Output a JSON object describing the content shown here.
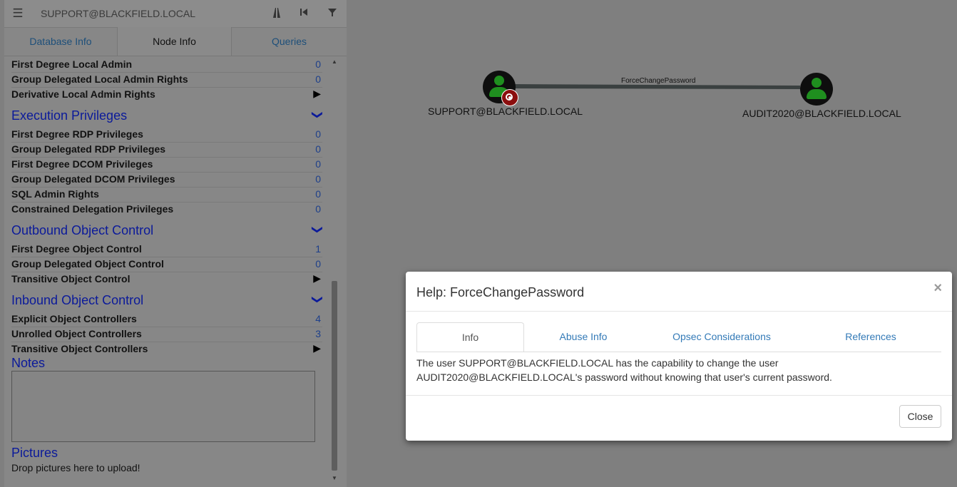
{
  "panel": {
    "search_value": "SUPPORT@BLACKFIELD.LOCAL",
    "icons": [
      "menu-icon",
      "pathfinding-icon",
      "back-icon",
      "filter-icon"
    ],
    "tabs": [
      {
        "label": "Database Info",
        "active": false
      },
      {
        "label": "Node Info",
        "active": true
      },
      {
        "label": "Queries",
        "active": false
      }
    ],
    "local_admin_rows": [
      {
        "label": "First Degree Local Admin",
        "value": "0"
      },
      {
        "label": "Group Delegated Local Admin Rights",
        "value": "0"
      },
      {
        "label": "Derivative Local Admin Rights",
        "value": "▶"
      }
    ],
    "execution": {
      "title": "Execution Privileges",
      "rows": [
        {
          "label": "First Degree RDP Privileges",
          "value": "0"
        },
        {
          "label": "Group Delegated RDP Privileges",
          "value": "0"
        },
        {
          "label": "First Degree DCOM Privileges",
          "value": "0"
        },
        {
          "label": "Group Delegated DCOM Privileges",
          "value": "0"
        },
        {
          "label": "SQL Admin Rights",
          "value": "0"
        },
        {
          "label": "Constrained Delegation Privileges",
          "value": "0"
        }
      ]
    },
    "outbound": {
      "title": "Outbound Object Control",
      "rows": [
        {
          "label": "First Degree Object Control",
          "value": "1"
        },
        {
          "label": "Group Delegated Object Control",
          "value": "0"
        },
        {
          "label": "Transitive Object Control",
          "value": "▶"
        }
      ]
    },
    "inbound": {
      "title": "Inbound Object Control",
      "rows": [
        {
          "label": "Explicit Object Controllers",
          "value": "4"
        },
        {
          "label": "Unrolled Object Controllers",
          "value": "3"
        },
        {
          "label": "Transitive Object Controllers",
          "value": "▶"
        }
      ]
    },
    "notes_title": "Notes",
    "pictures_title": "Pictures",
    "pictures_hint": "Drop pictures here to upload!"
  },
  "graph": {
    "source_node": "SUPPORT@BLACKFIELD.LOCAL",
    "target_node": "AUDIT2020@BLACKFIELD.LOCAL",
    "edge_label": "ForceChangePassword"
  },
  "modal": {
    "title": "Help: ForceChangePassword",
    "close_x": "×",
    "tabs": [
      {
        "label": "Info",
        "active": true
      },
      {
        "label": "Abuse Info",
        "active": false
      },
      {
        "label": "Opsec Considerations",
        "active": false
      },
      {
        "label": "References",
        "active": false
      }
    ],
    "body": "The user SUPPORT@BLACKFIELD.LOCAL has the capability to change the user AUDIT2020@BLACKFIELD.LOCAL's password without knowing that user's current password.",
    "close_button": "Close"
  },
  "colors": {
    "background": "#7f7f7f",
    "section_title": "#0b1a9a",
    "link": "#337ab7",
    "user_node": "#1f8f1f",
    "owned_marker": "#8b0e0e"
  }
}
